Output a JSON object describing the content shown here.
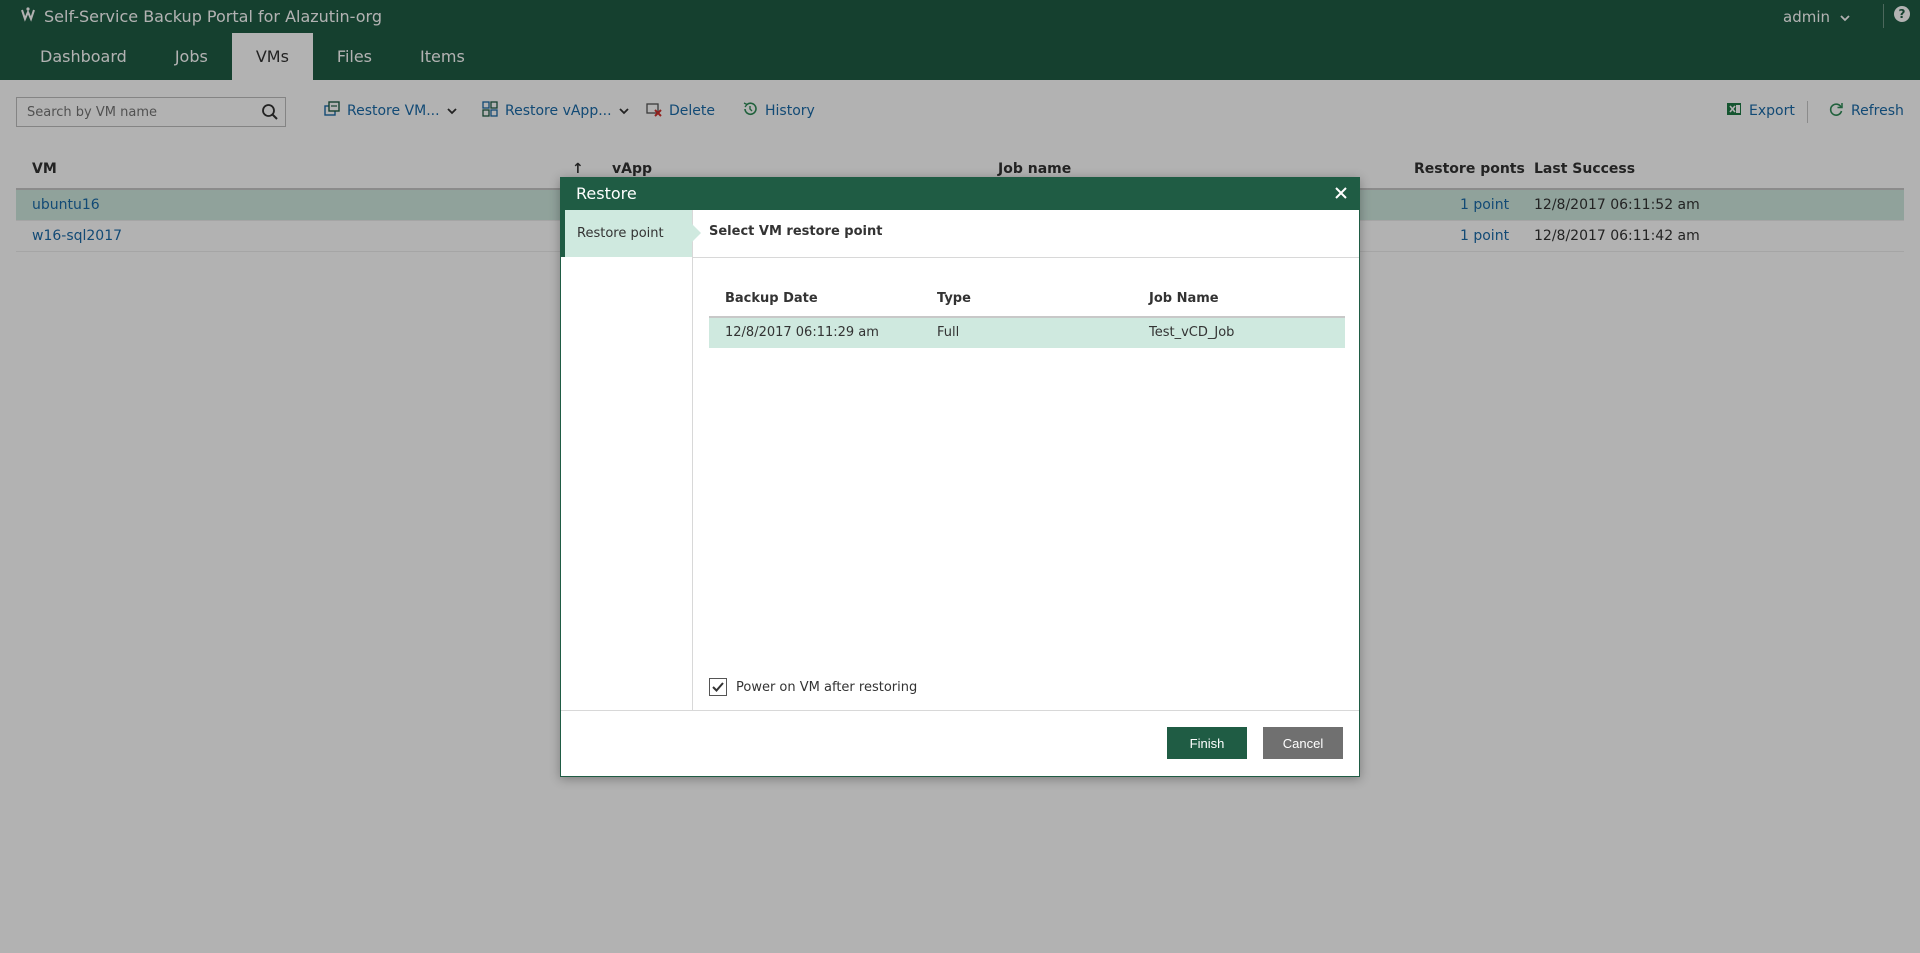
{
  "app": {
    "title": "Self-Service Backup Portal for Alazutin-org",
    "user": "admin",
    "help_label": "?"
  },
  "tabs": [
    "Dashboard",
    "Jobs",
    "VMs",
    "Files",
    "Items"
  ],
  "active_tab": "VMs",
  "toolbar": {
    "search_placeholder": "Search by VM name",
    "restore_vm": "Restore VM...",
    "restore_vapp": "Restore vApp...",
    "delete": "Delete",
    "history": "History",
    "export": "Export",
    "refresh": "Refresh"
  },
  "grid": {
    "columns": {
      "vm": "VM",
      "vapp": "vApp",
      "job_name": "Job name",
      "restore_points": "Restore ponts",
      "last_success": "Last Success"
    },
    "sort_indicator": "↑",
    "rows": [
      {
        "vm": "ubuntu16",
        "vapp": "",
        "job_name": "",
        "restore_points": "1 point",
        "last_success": "12/8/2017 06:11:52 am"
      },
      {
        "vm": "w16-sql2017",
        "vapp": "",
        "job_name": "",
        "restore_points": "1 point",
        "last_success": "12/8/2017 06:11:42 am"
      }
    ]
  },
  "dialog": {
    "title": "Restore",
    "step_label": "Restore point",
    "subtitle": "Select VM restore point",
    "table": {
      "columns": {
        "backup_date": "Backup Date",
        "type": "Type",
        "job_name": "Job Name"
      },
      "rows": [
        {
          "backup_date": "12/8/2017 06:11:29 am",
          "type": "Full",
          "job_name": "Test_vCD_Job"
        }
      ]
    },
    "power_on_label": "Power on VM after restoring",
    "power_on_checked": true,
    "finish": "Finish",
    "cancel": "Cancel"
  },
  "colors": {
    "brand": "#1f5c44",
    "link": "#1a6aa8",
    "selected_row": "#cfe9df"
  }
}
